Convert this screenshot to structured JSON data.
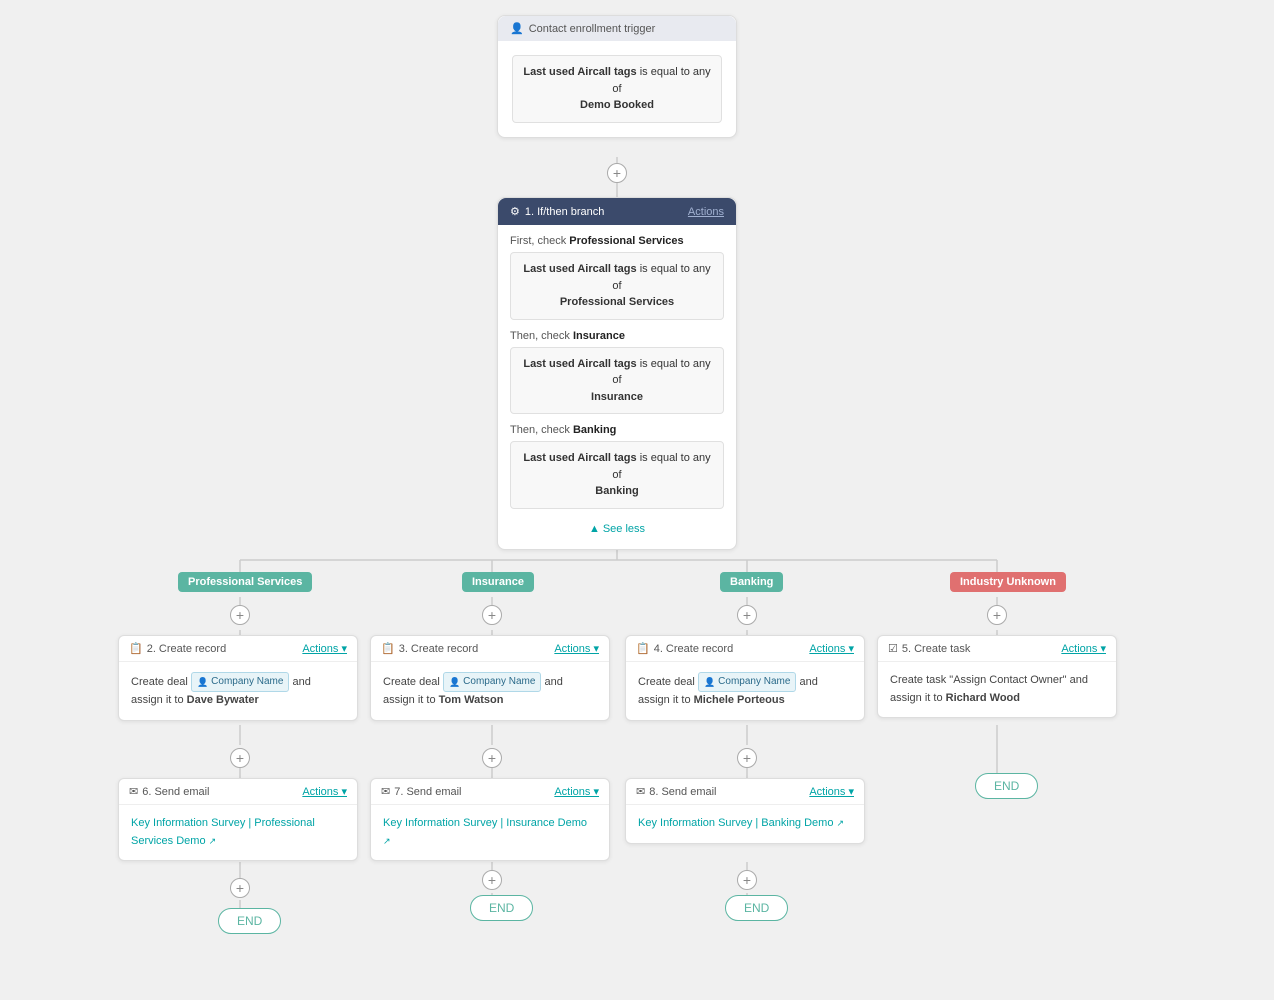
{
  "trigger": {
    "header": "Contact enrollment trigger",
    "condition": {
      "label": "Last used Aircall tags",
      "operator": "is equal to any of",
      "value": "Demo Booked"
    }
  },
  "branch": {
    "title": "1. If/then branch",
    "actions_label": "Actions",
    "sections": [
      {
        "prefix": "First, check",
        "name": "Professional Services",
        "condition_label": "Last used Aircall tags",
        "operator": "is equal to any of",
        "value": "Professional Services"
      },
      {
        "prefix": "Then, check",
        "name": "Insurance",
        "condition_label": "Last used Aircall tags",
        "operator": "is equal to any of",
        "value": "Insurance"
      },
      {
        "prefix": "Then, check",
        "name": "Banking",
        "condition_label": "Last used Aircall tags",
        "operator": "is equal to any of",
        "value": "Banking"
      }
    ],
    "see_less": "See less"
  },
  "branch_labels": [
    {
      "id": "professional",
      "text": "Professional Services",
      "class": "label-professional"
    },
    {
      "id": "insurance",
      "text": "Insurance",
      "class": "label-insurance"
    },
    {
      "id": "banking",
      "text": "Banking",
      "class": "label-banking"
    },
    {
      "id": "unknown",
      "text": "Industry Unknown",
      "class": "label-unknown"
    }
  ],
  "create_records": [
    {
      "id": "create2",
      "title": "2. Create record",
      "actions_label": "Actions",
      "body_prefix": "Create deal",
      "token_label": "Company Name",
      "body_suffix": "and assign it to",
      "assignee": "Dave Bywater"
    },
    {
      "id": "create3",
      "title": "3. Create record",
      "actions_label": "Actions",
      "body_prefix": "Create deal",
      "token_label": "Company Name",
      "body_suffix": "and assign it to",
      "assignee": "Tom Watson"
    },
    {
      "id": "create4",
      "title": "4. Create record",
      "actions_label": "Actions",
      "body_prefix": "Create deal",
      "token_label": "Company Name",
      "body_suffix": "and assign it to",
      "assignee": "Michele Porteous"
    }
  ],
  "create_task": {
    "id": "task5",
    "title": "5. Create task",
    "actions_label": "Actions",
    "body": "Create task \"Assign Contact Owner\" and assign it to",
    "assignee": "Richard Wood"
  },
  "send_emails": [
    {
      "id": "email6",
      "title": "6. Send email",
      "actions_label": "Actions",
      "link_text": "Key Information Survey | Professional Services Demo",
      "has_ext": true
    },
    {
      "id": "email7",
      "title": "7. Send email",
      "actions_label": "Actions",
      "link_text": "Key Information Survey | Insurance Demo",
      "has_ext": true
    },
    {
      "id": "email8",
      "title": "8. Send email",
      "actions_label": "Actions",
      "link_text": "Key Information Survey | Banking Demo",
      "has_ext": true
    }
  ],
  "end_label": "END"
}
